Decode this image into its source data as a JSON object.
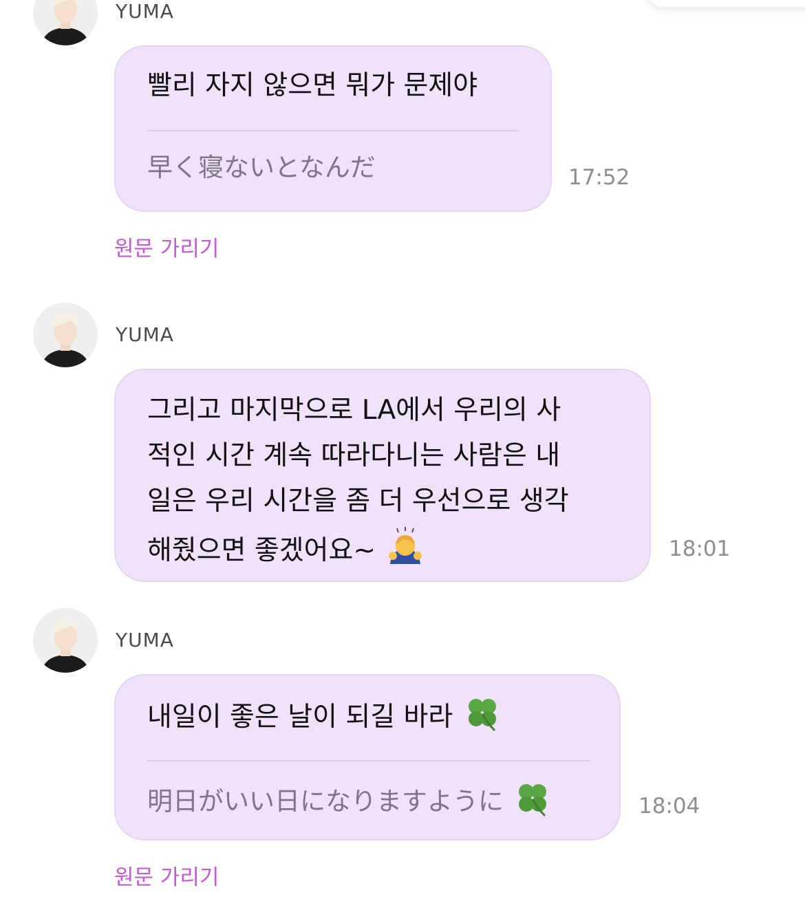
{
  "messages": [
    {
      "sender": "YUMA",
      "text": "빨리 자지 않으면 뭐가 문제야",
      "original": "早く寝ないとなんだ",
      "time": "17:52",
      "hide_label": "원문 가리기"
    },
    {
      "sender": "YUMA",
      "lines": [
        "그리고 마지막으로 LA에서 우리의 사",
        "적인 시간 계속 따라다니는 사람은 내",
        "일은 우리 시간을 좀 더 우선으로 생각",
        "해줬으면 좋겠어요~"
      ],
      "emoji": "bowing-person-emoji",
      "time": "18:01"
    },
    {
      "sender": "YUMA",
      "text": "내일이 좋은 날이 되길 바라",
      "original": "明日がいい日になりますように",
      "emoji": "four-leaf-clover-emoji",
      "time": "18:04",
      "hide_label": "원문 가리기"
    }
  ],
  "colors": {
    "bubble": "#f0e2fb",
    "link": "#c25ad6",
    "timestamp": "#8e8e8e"
  }
}
